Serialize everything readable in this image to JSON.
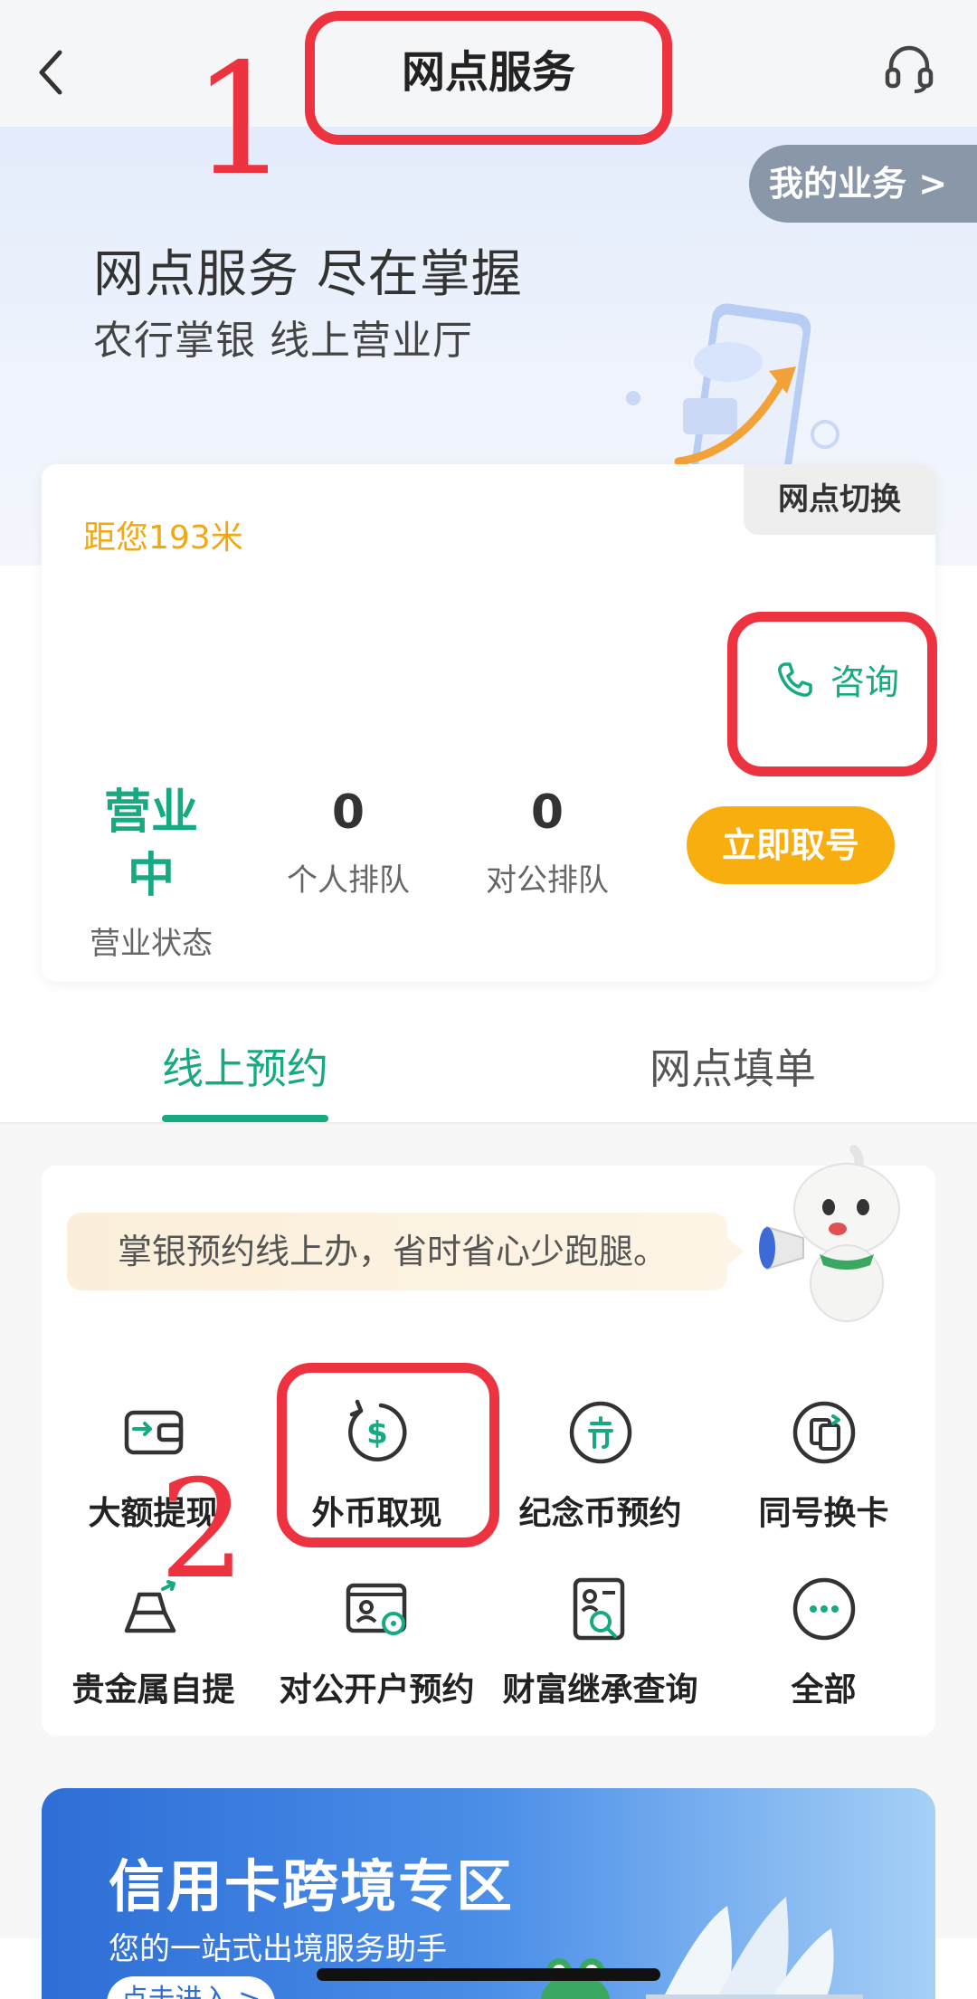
{
  "header": {
    "title": "网点服务",
    "back_icon": "chevron-left-icon",
    "support_icon": "headset-icon"
  },
  "annotations": {
    "marker_1": "1",
    "marker_2": "2",
    "color": "#ee3340"
  },
  "hero": {
    "title": "网点服务 尽在掌握",
    "subtitle": "农行掌银 线上营业厅",
    "my_business": "我的业务 >"
  },
  "branch": {
    "switch_label": "网点切换",
    "distance": "距您193米",
    "consult_label": "咨询",
    "status": [
      {
        "value": "营业中",
        "label": "营业状态"
      },
      {
        "value": "0",
        "label": "个人排队"
      },
      {
        "value": "0",
        "label": "对公排队"
      }
    ],
    "take_number": "立即取号"
  },
  "tabs": [
    {
      "label": "线上预约",
      "active": true
    },
    {
      "label": "网点填单",
      "active": false
    }
  ],
  "services": {
    "tip": "掌银预约线上办，省时省心少跑腿。",
    "items": [
      {
        "label": "大额提现",
        "icon": "wallet-transfer-icon"
      },
      {
        "label": "外币取现",
        "icon": "dollar-refresh-icon"
      },
      {
        "label": "纪念币预约",
        "icon": "coin-icon"
      },
      {
        "label": "同号换卡",
        "icon": "card-swap-icon"
      },
      {
        "label": "贵金属自提",
        "icon": "gold-bar-icon"
      },
      {
        "label": "对公开户预约",
        "icon": "account-card-icon"
      },
      {
        "label": "财富继承查询",
        "icon": "document-search-icon"
      },
      {
        "label": "全部",
        "icon": "more-icon"
      }
    ]
  },
  "banner": {
    "title": "信用卡跨境专区",
    "subtitle": "您的一站式出境服务助手",
    "cta": "点击进入 >"
  },
  "colors": {
    "accent_green": "#17a982",
    "accent_orange": "#f8ae0f",
    "distance_text": "#f0a815"
  }
}
